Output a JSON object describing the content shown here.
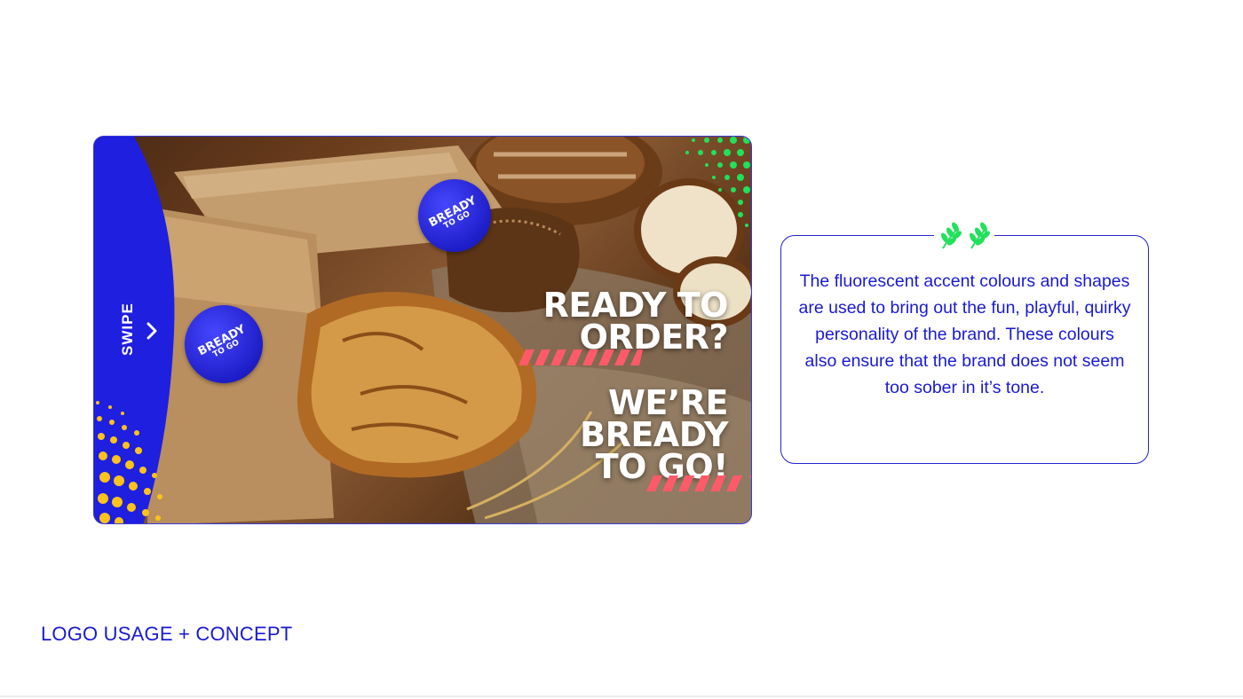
{
  "banner": {
    "swipe_label": "SWIPE",
    "headline_1_line_1": "READY TO",
    "headline_1_line_2": "ORDER?",
    "headline_2_line_1": "WE’RE",
    "headline_2_line_2": "BREADY",
    "headline_2_line_3": "TO GO!",
    "sticker_brand": "BREADY",
    "sticker_tagline": "TO GO"
  },
  "info": {
    "text": "The fluorescent accent colours and shapes are used to bring out the fun, playful, quirky personality of the brand. These colours also ensure that the brand does not seem too sober in it’s tone."
  },
  "footer": {
    "label": "LOGO USAGE + CONCEPT"
  },
  "colors": {
    "brand_blue": "#1f1fe0",
    "accent_green": "#22e05a",
    "accent_yellow": "#ffc21a",
    "accent_coral": "#ff5a6a"
  },
  "icons": {
    "wheat": "wheat-icon",
    "swipe_arrow": "chevron-right-icon"
  }
}
